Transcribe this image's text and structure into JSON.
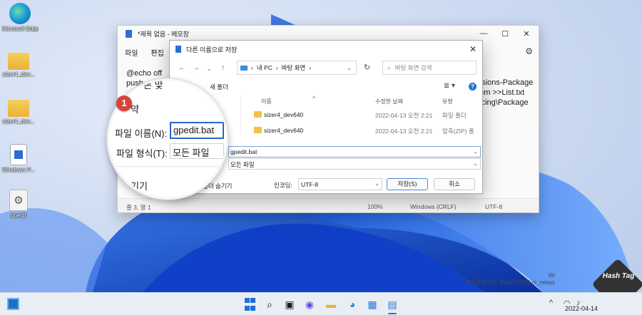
{
  "desktop": {
    "icons": [
      {
        "label": "Microsoft Edge",
        "icon": "edge-icon"
      },
      {
        "label": "sizer4_dev...",
        "icon": "folder-icon"
      },
      {
        "label": "sizer4_dev...",
        "icon": "folder-icon"
      },
      {
        "label": "Windows P...",
        "icon": "installer-file-icon"
      },
      {
        "label": "gpedit",
        "icon": "batch-file-gear-icon"
      }
    ]
  },
  "notepad": {
    "title": "*제목 없음 - 메모장",
    "menu": [
      "파일",
      "편집"
    ],
    "text_lines": [
      "@echo off",
      "push",
      "",
      ""
    ],
    "right_text_lines": [
      "ensions-Package",
      "mum >>List.txt",
      "rvicing\\Package"
    ],
    "status": {
      "position": "줄 3, 열 1",
      "zoom": "100%",
      "line_ending": "Windows (CRLF)",
      "encoding": "UTF-8"
    }
  },
  "dialog": {
    "title": "다른 이름으로 저장",
    "address": {
      "root": "내 PC",
      "folder": "바탕 화면"
    },
    "search_placeholder": "바탕 화면 검색",
    "new_folder": "새 폴더",
    "columns": {
      "name": "이름",
      "modified": "수정한 날짜",
      "type": "유형"
    },
    "files": [
      {
        "name": "sizer4_dev640",
        "modified": "2022-04-13 오전 2:21",
        "type": "파일 폴더"
      },
      {
        "name": "sizer4_dev640",
        "modified": "2022-04-13 오전 2:21",
        "type": "압축(ZIP) 폴"
      }
    ],
    "filename_label": "파일 이름(N):",
    "filename_value": "gpedit.bat",
    "filetype_label": "파일 형식(T):",
    "filetype_value": "모든 파일",
    "hide_folders": "폴더 숨기기",
    "encoding_label": "인코딩:",
    "encoding_value": "UTF-8",
    "save_button": "저장(S)",
    "cancel_button": "취소"
  },
  "magnifier": {
    "menu_fragment_top": "본 맟",
    "menu_fragment_side": "약",
    "filename_label": "파일 이름(N):",
    "filename_value": "gpedit.bat",
    "filetype_label": "파일 형식(T):",
    "filetype_value": "모든 파일",
    "bottom_fragment": "기기",
    "step_badge": "1"
  },
  "watermark": {
    "line1": "Wi",
    "line2": "평가본입니다. Build 22593.ni_releas"
  },
  "hashtag": {
    "text": "Hash Tag"
  },
  "taskbar": {
    "date": "2022-04-14",
    "tray_lang": "A"
  },
  "colors": {
    "accent": "#2a6fd6",
    "badge": "#d9433a",
    "folder": "#f0c14b"
  }
}
